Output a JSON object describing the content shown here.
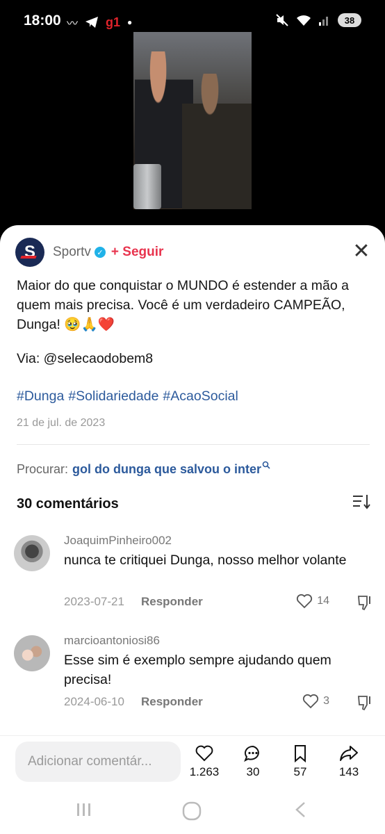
{
  "status_bar": {
    "time": "18:00",
    "g1": "g1",
    "battery": "38",
    "icons": [
      "wave-icon",
      "telegram-icon",
      "g1-icon",
      "dot-icon",
      "mute-icon",
      "wifi-icon",
      "signal-icon",
      "battery-icon"
    ]
  },
  "post": {
    "account_name": "Sportv",
    "follow_label": "+ Seguir",
    "caption": "Maior do que conquistar o MUNDO é estender a mão a quem mais precisa. Você é um verdadeiro CAMPEÃO, Dunga! 🥹🙏❤️",
    "via": "Via: @selecaodobem8",
    "hashtags": [
      "#Dunga",
      "#Solidariedade",
      "#AcaoSocial"
    ],
    "date": "21 de jul. de 2023"
  },
  "search": {
    "prefix": "Procurar:",
    "query": "gol do dunga que salvou o inter"
  },
  "comments_header": {
    "count_label": "30 comentários"
  },
  "comments": [
    {
      "user": "JoaquimPinheiro002",
      "text": "nunca te critiquei Dunga, nosso melhor volante",
      "date": "2023-07-21",
      "reply_label": "Responder",
      "likes": "14"
    },
    {
      "user": "marcioantoniosi86",
      "text": "Esse sim é exemplo sempre ajudando quem precisa!",
      "date": "2024-06-10",
      "reply_label": "Responder",
      "likes": "3"
    }
  ],
  "action_bar": {
    "input_placeholder": "Adicionar comentár...",
    "likes": "1.263",
    "comments": "30",
    "saves": "57",
    "shares": "143"
  },
  "colors": {
    "accent_red": "#e8344e",
    "link_blue": "#2c5a9c",
    "verified_blue": "#20b2e8"
  }
}
